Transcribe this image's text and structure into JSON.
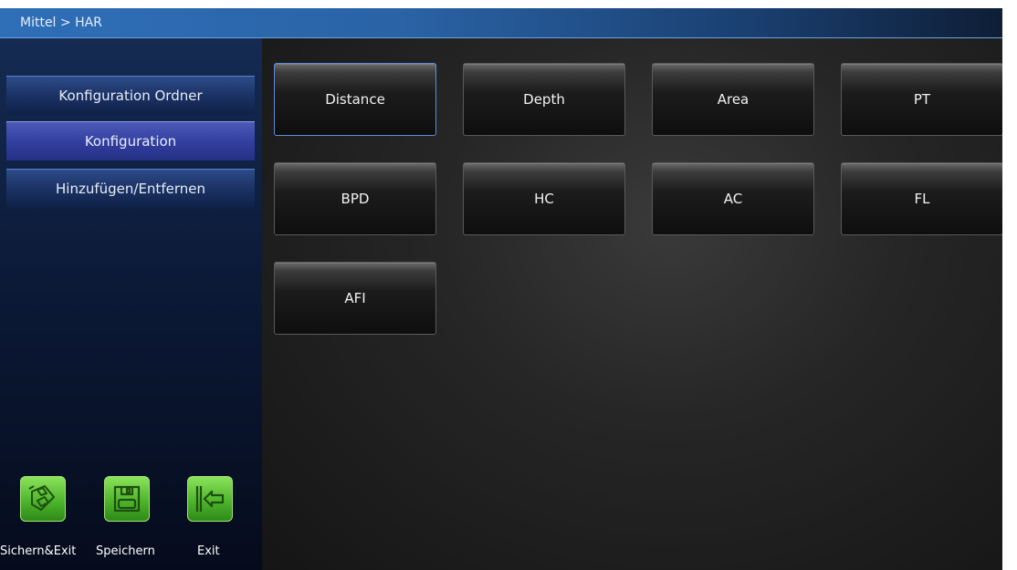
{
  "header": {
    "breadcrumb": "Mittel > HAR"
  },
  "sidebar": {
    "items": [
      {
        "label": "Konfiguration Ordner",
        "selected": false
      },
      {
        "label": "Konfiguration",
        "selected": true
      },
      {
        "label": "Hinzufügen/Entfernen",
        "selected": false
      }
    ]
  },
  "items": [
    "Distance",
    "Depth",
    "Area",
    "PT",
    "BPD",
    "HC",
    "AC",
    "FL",
    "AFI"
  ],
  "selected_item": "Distance",
  "toolbar": {
    "save_exit_label": "Sichern&Exit",
    "save_label": "Speichern",
    "exit_label": "Exit"
  },
  "colors": {
    "title_bar": "#2a63a6",
    "sidebar_bg": "#0c1a38",
    "menu_item": "#1b3264",
    "menu_selected": "#3440a0",
    "tile_bg": "#1c1c1c",
    "tile_active_border": "#5d8ed8",
    "tool_green": "#4eb52c"
  }
}
